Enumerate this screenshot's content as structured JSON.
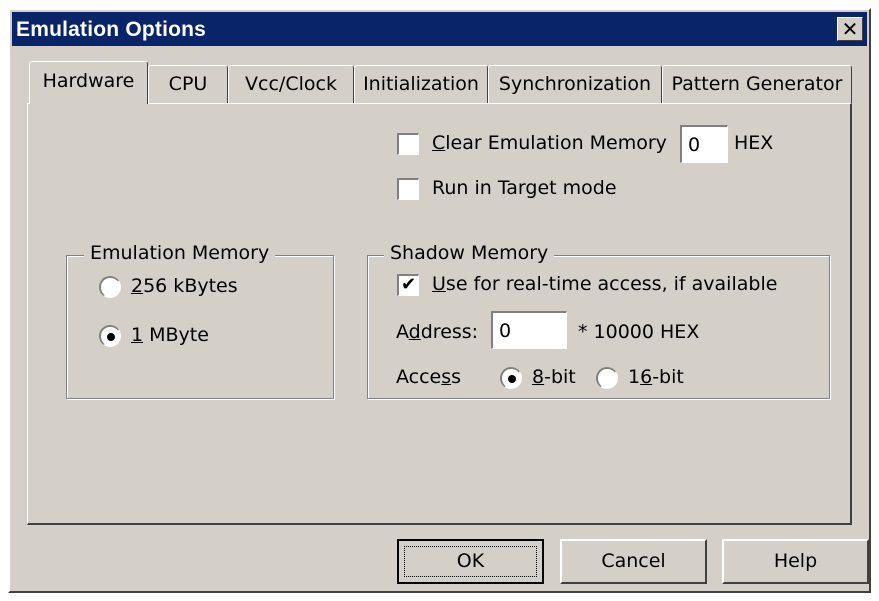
{
  "window": {
    "title": "Emulation Options",
    "close_glyph": "✕"
  },
  "tabs": [
    "Hardware",
    "CPU",
    "Vcc/Clock",
    "Initialization",
    "Synchronization",
    "Pattern Generator"
  ],
  "active_tab": "Hardware",
  "clear_emulation_memory": {
    "label": "Clear Emulation Memory",
    "checked": false,
    "value": "0",
    "suffix": "HEX"
  },
  "run_in_target_mode": {
    "label": "Run in Target mode",
    "checked": false
  },
  "emulation_memory": {
    "title": "Emulation Memory",
    "options": [
      {
        "label": "256 kBytes",
        "selected": false
      },
      {
        "label": "1 MByte",
        "selected": true
      }
    ]
  },
  "shadow_memory": {
    "title": "Shadow Memory",
    "use_realtime": {
      "label": "Use for real-time access, if available",
      "checked": true
    },
    "address": {
      "label": "Address:",
      "value": "0",
      "suffix": "* 10000 HEX"
    },
    "access": {
      "label": "Access",
      "options": [
        {
          "label": "8-bit",
          "selected": true
        },
        {
          "label": "16-bit",
          "selected": false
        }
      ]
    }
  },
  "buttons": {
    "ok": "OK",
    "cancel": "Cancel",
    "help": "Help"
  },
  "icons": {
    "close": "close-icon",
    "checkmark": "checkmark-icon"
  },
  "colors": {
    "titlebar": "#0a246a",
    "face": "#d4d0c8"
  }
}
